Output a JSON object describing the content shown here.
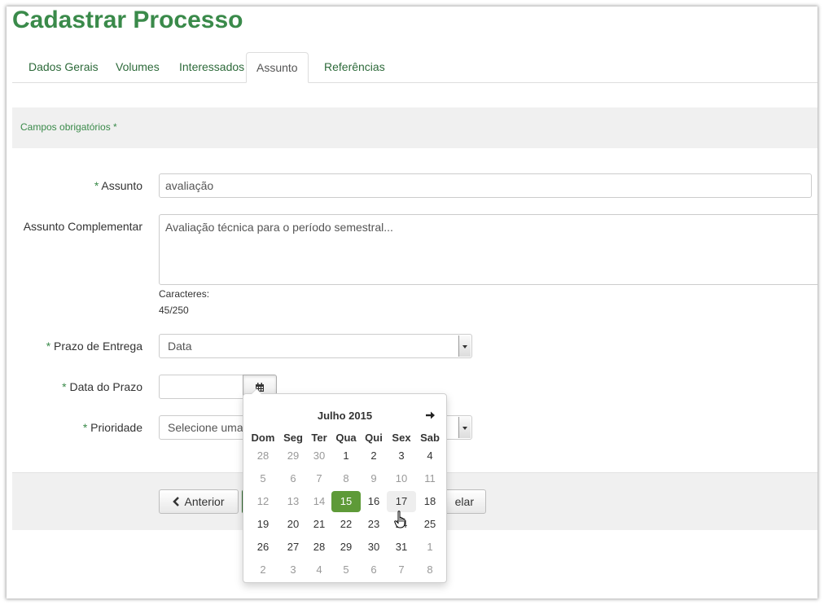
{
  "page": {
    "title": "Cadastrar Processo"
  },
  "tabs": [
    {
      "label": "Dados Gerais"
    },
    {
      "label": "Volumes"
    },
    {
      "label": "Interessados"
    },
    {
      "label": "Assunto",
      "active": true
    },
    {
      "label": "Referências"
    }
  ],
  "required_notice": "Campos obrigatórios *",
  "form": {
    "assunto": {
      "star": "*",
      "label": "Assunto",
      "value": "avaliação"
    },
    "assunto_complementar": {
      "label": "Assunto Complementar",
      "value": "Avaliação técnica para o período semestral...",
      "counter_label": "Caracteres:",
      "counter_value": "45/250"
    },
    "prazo_entrega": {
      "star": "*",
      "label": "Prazo de Entrega",
      "selected": "Data"
    },
    "data_prazo": {
      "star": "*",
      "label": "Data do Prazo",
      "value": ""
    },
    "prioridade": {
      "star": "*",
      "label": "Prioridade",
      "selected": "Selecione uma"
    }
  },
  "footer": {
    "prev_label": "Anterior",
    "cancel_label_visible": "elar"
  },
  "datepicker": {
    "month_label": "Julho 2015",
    "weekdays": [
      "Dom",
      "Seg",
      "Ter",
      "Qua",
      "Qui",
      "Sex",
      "Sab"
    ],
    "weeks": [
      [
        "28",
        "29",
        "30",
        "1",
        "2",
        "3",
        "4"
      ],
      [
        "5",
        "6",
        "7",
        "8",
        "9",
        "10",
        "11"
      ],
      [
        "12",
        "13",
        "14",
        "15",
        "16",
        "17",
        "18"
      ],
      [
        "19",
        "20",
        "21",
        "22",
        "23",
        "24",
        "25"
      ],
      [
        "26",
        "27",
        "28",
        "29",
        "30",
        "31",
        "1"
      ],
      [
        "2",
        "3",
        "4",
        "5",
        "6",
        "7",
        "8"
      ]
    ],
    "selected_day": "15",
    "hovered_day": "17",
    "icons": {
      "next": "arrow-right-icon",
      "calendar": "calendar-icon",
      "prev": "chevron-left-icon"
    },
    "colors": {
      "selected": "#5e9a38",
      "hover": "#eeeeee"
    }
  },
  "colors": {
    "brand_green": "#3a8a4a",
    "panel_bg": "#f0f0f0"
  }
}
